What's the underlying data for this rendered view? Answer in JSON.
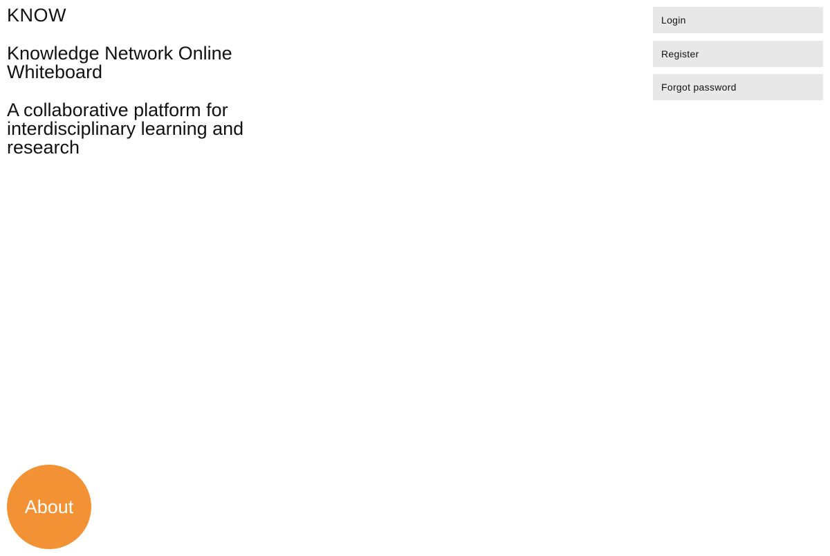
{
  "brand": {
    "logo": "KNOW",
    "title": "Knowledge Network Online Whiteboard",
    "tagline": "A collaborative platform for interdisciplinary learning and research"
  },
  "auth": {
    "login_label": "Login",
    "register_label": "Register",
    "forgot_label": "Forgot password"
  },
  "about": {
    "label": "About"
  },
  "colors": {
    "accent": "#f39234",
    "button_bg": "#e8e8e8",
    "text": "#111111",
    "background": "#ffffff"
  }
}
